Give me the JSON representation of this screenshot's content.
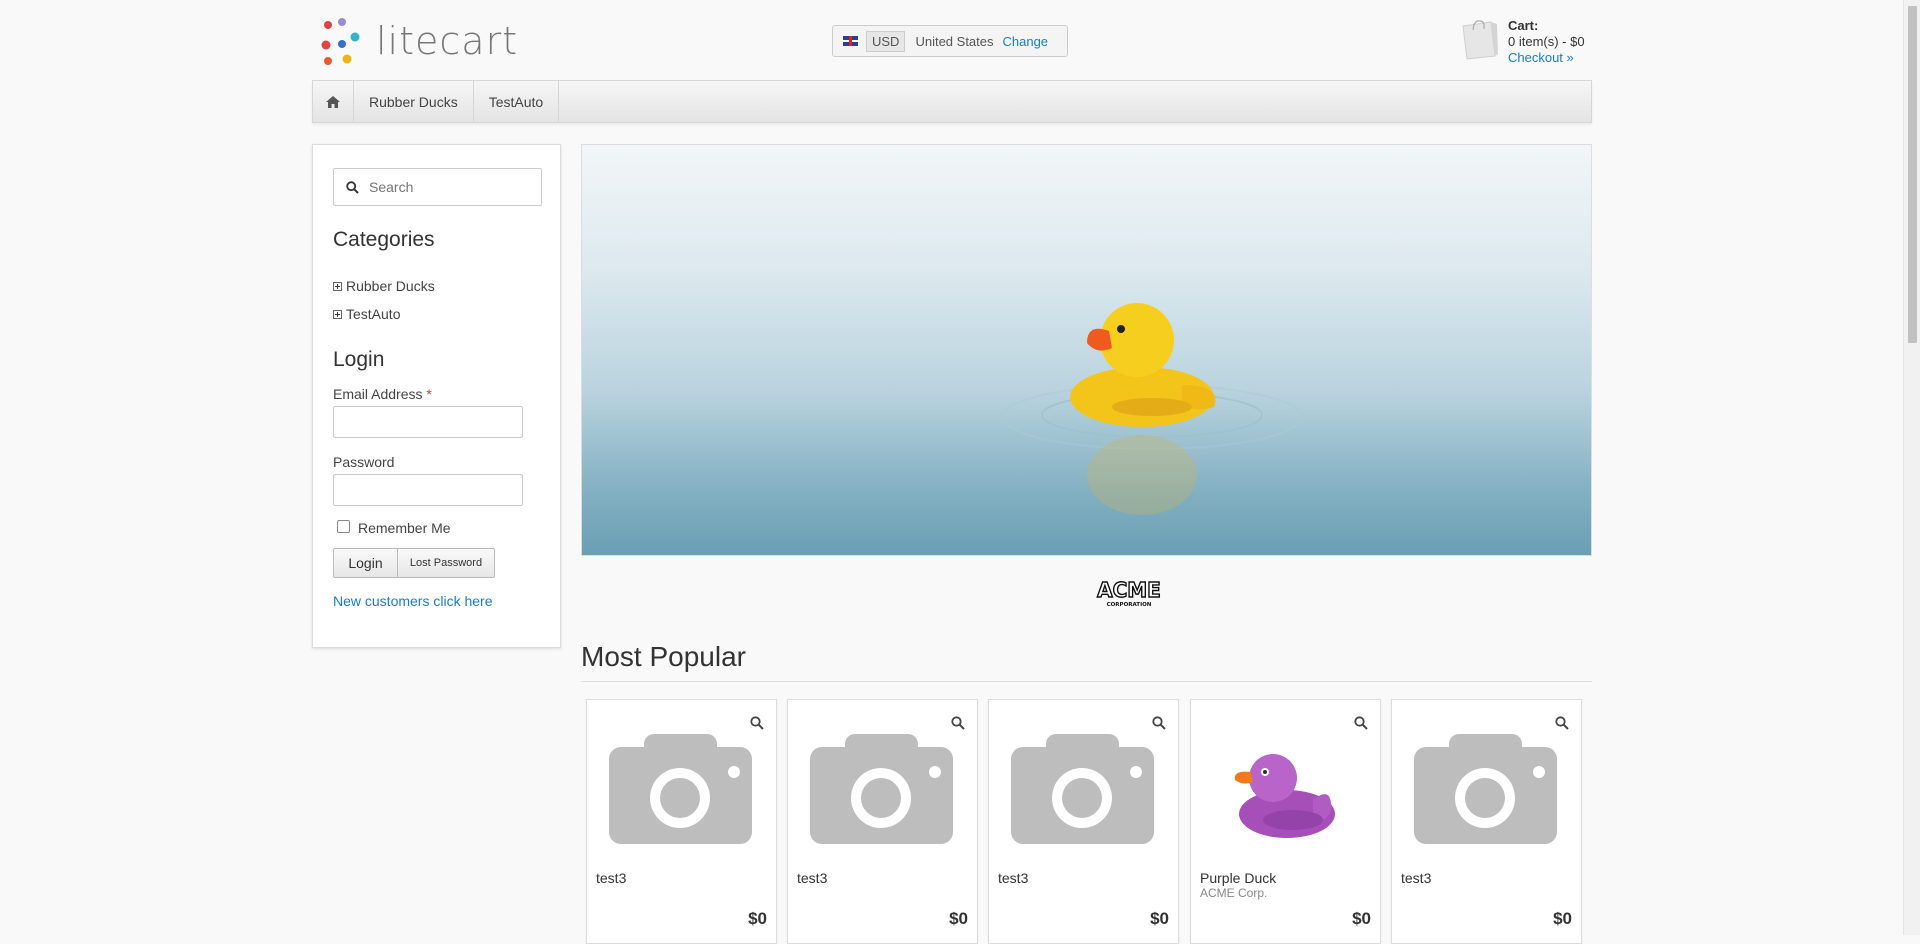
{
  "header": {
    "logo_text": "litecart",
    "region": {
      "currency": "USD",
      "country": "United States",
      "change_label": "Change"
    },
    "cart": {
      "title": "Cart:",
      "summary": "0 item(s) - $0",
      "checkout_label": "Checkout »"
    }
  },
  "nav": {
    "items": [
      {
        "label": "Rubber Ducks"
      },
      {
        "label": "TestAuto"
      }
    ]
  },
  "sidebar": {
    "search_placeholder": "Search",
    "categories_title": "Categories",
    "categories": [
      {
        "label": "Rubber Ducks"
      },
      {
        "label": "TestAuto"
      }
    ],
    "login_title": "Login",
    "email_label": "Email Address",
    "required_mark": "*",
    "password_label": "Password",
    "remember_label": "Remember Me",
    "login_button": "Login",
    "lost_password_button": "Lost Password",
    "new_customers_link": "New customers click here"
  },
  "main": {
    "most_popular_title": "Most Popular",
    "manufacturer_logo": "ACME CORPORATION",
    "products": [
      {
        "name": "test3",
        "manufacturer": "",
        "price": "$0",
        "image": "placeholder-camera"
      },
      {
        "name": "test3",
        "manufacturer": "",
        "price": "$0",
        "image": "placeholder-camera"
      },
      {
        "name": "test3",
        "manufacturer": "",
        "price": "$0",
        "image": "placeholder-camera"
      },
      {
        "name": "Purple Duck",
        "manufacturer": "ACME Corp.",
        "price": "$0",
        "image": "purple-duck"
      },
      {
        "name": "test3",
        "manufacturer": "",
        "price": "$0",
        "image": "placeholder-camera"
      }
    ]
  },
  "icons": {
    "home": "home-icon",
    "search": "search-icon",
    "zoom": "zoom-icon",
    "cart": "shopping-bag-icon"
  },
  "colors": {
    "link": "#1a7dc4",
    "logo_dots": [
      "#e04343",
      "#3b6fc4",
      "#2fb5c9",
      "#f2b21c",
      "#9b59b6"
    ]
  }
}
